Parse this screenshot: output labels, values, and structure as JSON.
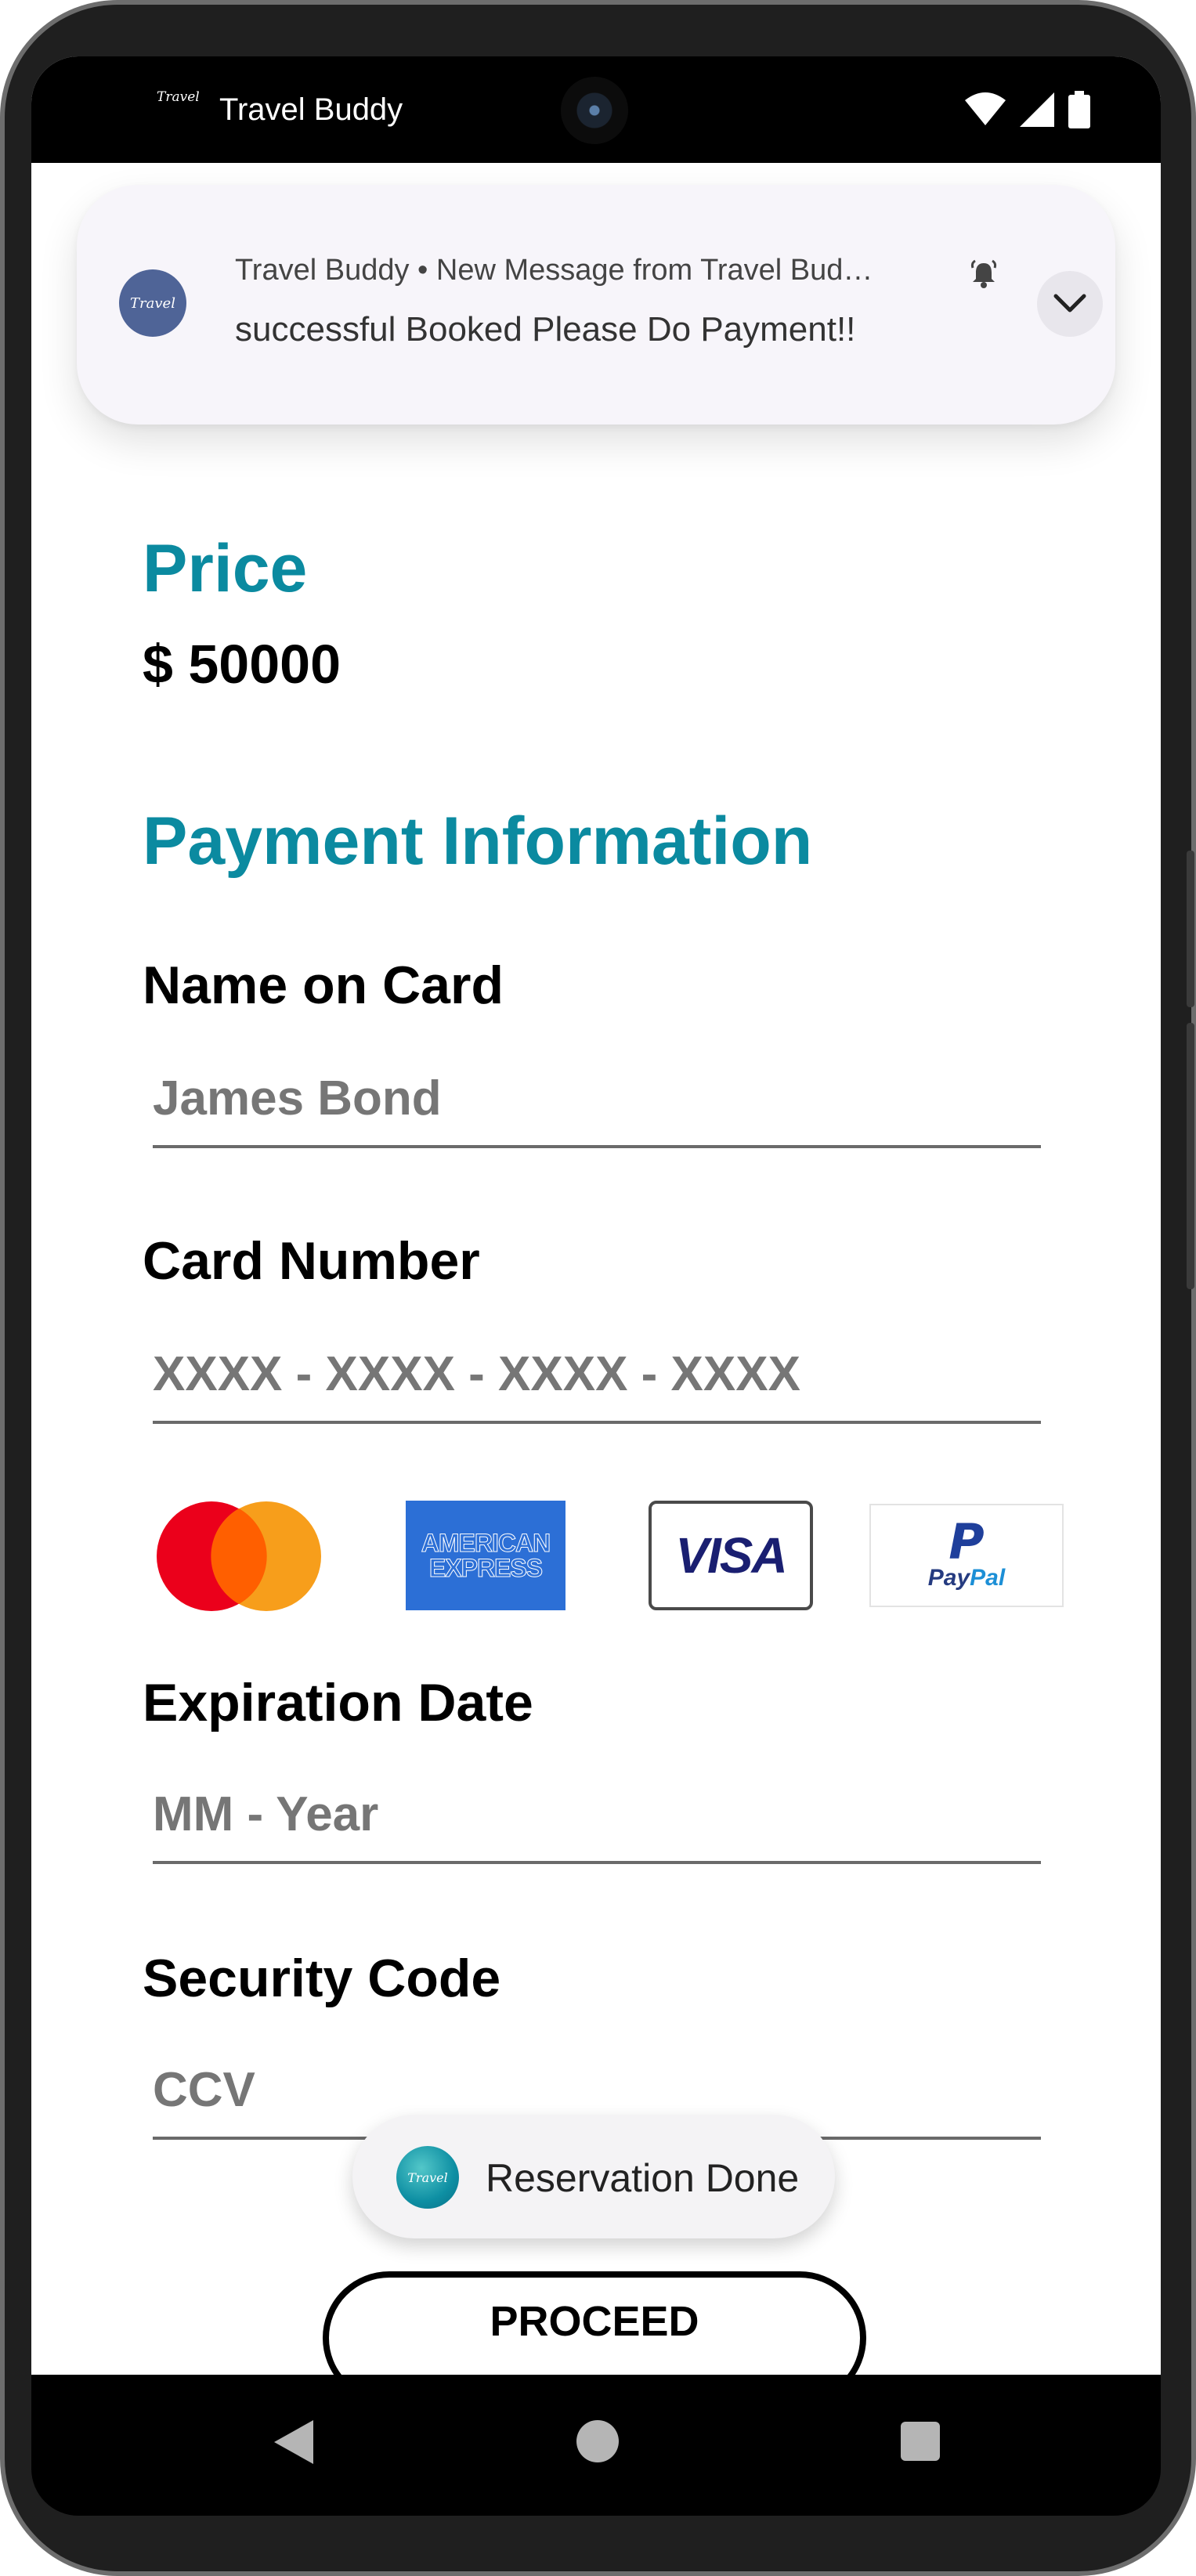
{
  "status_bar": {
    "app_name": "Travel Buddy",
    "logo_text": "Travel",
    "icons": [
      "wifi-icon",
      "signal-icon",
      "battery-icon"
    ]
  },
  "notification": {
    "header": "Travel Buddy • New Message from Travel Bud…",
    "body": "successful Booked Please Do Payment!!",
    "avatar_text": "Travel",
    "icons": [
      "bell-icon",
      "chevron-down-icon"
    ]
  },
  "price": {
    "title": "Price",
    "value": "$ 50000"
  },
  "payment": {
    "title": "Payment Information",
    "name_label": "Name on Card",
    "name_placeholder": "James Bond",
    "card_label": "Card Number",
    "card_placeholder": "XXXX - XXXX - XXXX - XXXX",
    "expiry_label": "Expiration Date",
    "expiry_placeholder": "MM - Year",
    "security_label": "Security Code",
    "security_placeholder": "CCV"
  },
  "card_logos": {
    "amex_line1": "AMERICAN",
    "amex_line2": "EXPRESS",
    "visa": "VISA",
    "paypal_mark": "P",
    "paypal_pay": "Pay",
    "paypal_pal": "Pal"
  },
  "toast": {
    "text": "Reservation Done",
    "icon_text": "Travel"
  },
  "proceed_label": "PROCEED",
  "colors": {
    "accent": "#0b8aa0",
    "mastercard_red": "#eb001b",
    "mastercard_orange": "#f79e1b",
    "amex_blue": "#2c6fd6",
    "visa_blue": "#1a1f71",
    "paypal_blue": "#253b80"
  }
}
